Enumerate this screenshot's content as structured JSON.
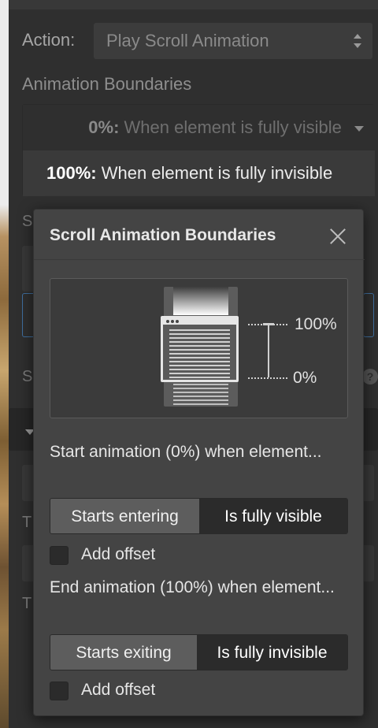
{
  "action": {
    "label": "Action:",
    "value": "Play Scroll Animation"
  },
  "boundaries": {
    "title": "Animation Boundaries",
    "start_pct": "0%:",
    "start_text": "When element is fully visible",
    "end_pct": "100%:",
    "end_text": "When element is fully invisible"
  },
  "underlying": {
    "s1": "S",
    "s2": "S",
    "t1": "T",
    "t2": "T"
  },
  "modal": {
    "title": "Scroll Animation Boundaries",
    "diagram": {
      "label_top": "100%",
      "label_bottom": "0%"
    },
    "start_question": "Start animation (0%) when element...",
    "start_options": [
      "Starts entering",
      "Is fully visible"
    ],
    "start_selected": "Is fully visible",
    "start_offset_label": "Add offset",
    "end_question": "End animation (100%) when element...",
    "end_options": [
      "Starts exiting",
      "Is fully invisible"
    ],
    "end_selected": "Is fully invisible",
    "end_offset_label": "Add offset"
  },
  "colors": {
    "panel_bg": "#2f2f2f",
    "modal_bg": "#444444",
    "segment_selected": "#2b2b2b",
    "segment_unselected": "#5d5d5d"
  }
}
